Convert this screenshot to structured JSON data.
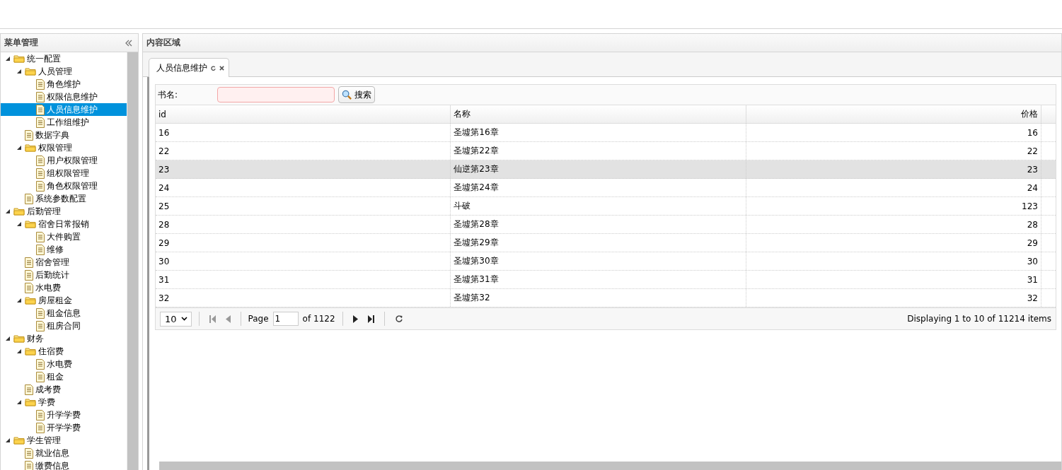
{
  "sidebar": {
    "title": "菜单管理",
    "items": [
      {
        "label": "统一配置",
        "kind": "folder",
        "expanded": true,
        "selected": false,
        "children": [
          {
            "label": "人员管理",
            "kind": "folder",
            "expanded": true,
            "selected": false,
            "children": [
              {
                "label": "角色维护",
                "kind": "file",
                "selected": false
              },
              {
                "label": "权限信息维护",
                "kind": "file",
                "selected": false
              },
              {
                "label": "人员信息维护",
                "kind": "file",
                "selected": true
              },
              {
                "label": "工作组维护",
                "kind": "file",
                "selected": false
              }
            ]
          },
          {
            "label": "数据字典",
            "kind": "file",
            "selected": false
          },
          {
            "label": "权限管理",
            "kind": "folder",
            "expanded": true,
            "selected": false,
            "children": [
              {
                "label": "用户权限管理",
                "kind": "file",
                "selected": false
              },
              {
                "label": "组权限管理",
                "kind": "file",
                "selected": false
              },
              {
                "label": "角色权限管理",
                "kind": "file",
                "selected": false
              }
            ]
          },
          {
            "label": "系统参数配置",
            "kind": "file",
            "selected": false
          }
        ]
      },
      {
        "label": "后勤管理",
        "kind": "folder",
        "expanded": true,
        "selected": false,
        "children": [
          {
            "label": "宿舍日常报销",
            "kind": "folder",
            "expanded": true,
            "selected": false,
            "children": [
              {
                "label": "大件购置",
                "kind": "file",
                "selected": false
              },
              {
                "label": "维修",
                "kind": "file",
                "selected": false
              }
            ]
          },
          {
            "label": "宿舍管理",
            "kind": "file",
            "selected": false
          },
          {
            "label": "后勤统计",
            "kind": "file",
            "selected": false
          },
          {
            "label": "水电费",
            "kind": "file",
            "selected": false
          },
          {
            "label": "房屋租金",
            "kind": "folder",
            "expanded": true,
            "selected": false,
            "children": [
              {
                "label": "租金信息",
                "kind": "file",
                "selected": false
              },
              {
                "label": "租房合同",
                "kind": "file",
                "selected": false
              }
            ]
          }
        ]
      },
      {
        "label": "财务",
        "kind": "folder",
        "expanded": true,
        "selected": false,
        "children": [
          {
            "label": "住宿费",
            "kind": "folder",
            "expanded": true,
            "selected": false,
            "children": [
              {
                "label": "水电费",
                "kind": "file",
                "selected": false
              },
              {
                "label": "租金",
                "kind": "file",
                "selected": false
              }
            ]
          },
          {
            "label": "成考费",
            "kind": "file",
            "selected": false
          },
          {
            "label": "学费",
            "kind": "folder",
            "expanded": true,
            "selected": false,
            "children": [
              {
                "label": "升学学费",
                "kind": "file",
                "selected": false
              },
              {
                "label": "开学学费",
                "kind": "file",
                "selected": false
              }
            ]
          }
        ]
      },
      {
        "label": "学生管理",
        "kind": "folder",
        "expanded": true,
        "selected": false,
        "children": [
          {
            "label": "就业信息",
            "kind": "file",
            "selected": false
          },
          {
            "label": "缴费信息",
            "kind": "file",
            "selected": false
          }
        ]
      }
    ]
  },
  "content": {
    "title": "内容区域",
    "tabs": [
      {
        "label": "人员信息维护",
        "selected": true
      }
    ],
    "search": {
      "label": "书名:",
      "button": "搜索"
    },
    "table": {
      "columns": [
        "id",
        "名称",
        "价格"
      ],
      "rows": [
        {
          "cells": [
            "16",
            "圣墟第16章",
            "16"
          ],
          "selected": false
        },
        {
          "cells": [
            "22",
            "圣墟第22章",
            "22"
          ],
          "selected": false
        },
        {
          "cells": [
            "23",
            "仙逆第23章",
            "23"
          ],
          "selected": true
        },
        {
          "cells": [
            "24",
            "圣墟第24章",
            "24"
          ],
          "selected": false
        },
        {
          "cells": [
            "25",
            "斗破",
            "123"
          ],
          "selected": false
        },
        {
          "cells": [
            "28",
            "圣墟第28章",
            "28"
          ],
          "selected": false
        },
        {
          "cells": [
            "29",
            "圣墟第29章",
            "29"
          ],
          "selected": false
        },
        {
          "cells": [
            "30",
            "圣墟第30章",
            "30"
          ],
          "selected": false
        },
        {
          "cells": [
            "31",
            "圣墟第31章",
            "31"
          ],
          "selected": false
        },
        {
          "cells": [
            "32",
            "圣墟第32",
            "32"
          ],
          "selected": false
        }
      ]
    },
    "pager": {
      "page_size": "10",
      "page_label": "Page",
      "page": "1",
      "of_label": "of 1122",
      "first_disabled": true,
      "prev_disabled": true,
      "next_disabled": false,
      "last_disabled": false,
      "info": "Displaying 1 to 10 of 11214 items"
    }
  }
}
